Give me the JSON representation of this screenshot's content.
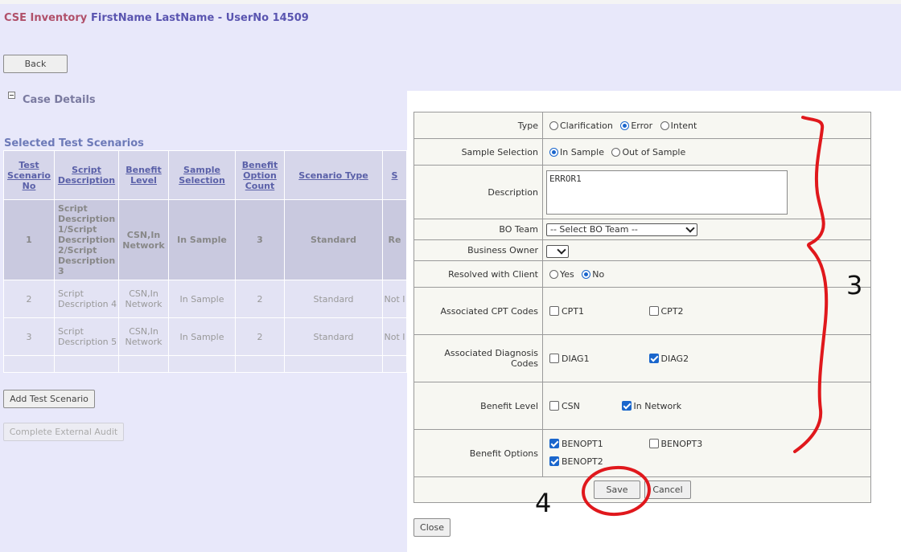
{
  "header": {
    "app_name": "CSE Inventory",
    "user": "FirstName LastName - UserNo 14509"
  },
  "buttons": {
    "back": "Back",
    "add_test_scenario": "Add Test Scenario",
    "complete_external_audit": "Complete External Audit",
    "close": "Close",
    "save": "Save",
    "cancel": "Cancel"
  },
  "case_details": {
    "title": "Case Details"
  },
  "scenarios": {
    "title": "Selected Test Scenarios",
    "columns": [
      "Test Scenario No",
      "Script Description",
      "Benefit Level",
      "Sample Selection",
      "Benefit Option Count",
      "Scenario Type",
      "S"
    ],
    "rows": [
      {
        "no": "1",
        "desc": "Script Description 1/Script Description 2/Script Description 3",
        "level": "CSN,In Network",
        "sample": "In Sample",
        "count": "3",
        "type": "Standard",
        "status": "Re"
      },
      {
        "no": "2",
        "desc": "Script Description 4",
        "level": "CSN,In Network",
        "sample": "In Sample",
        "count": "2",
        "type": "Standard",
        "status": "Not I"
      },
      {
        "no": "3",
        "desc": "Script Description 5",
        "level": "CSN,In Network",
        "sample": "In Sample",
        "count": "2",
        "type": "Standard",
        "status": "Not I"
      }
    ]
  },
  "form": {
    "type": {
      "label": "Type",
      "options": [
        "Clarification",
        "Error",
        "Intent"
      ],
      "selected": "Error"
    },
    "sample_selection": {
      "label": "Sample Selection",
      "options": [
        "In Sample",
        "Out of Sample"
      ],
      "selected": "In Sample"
    },
    "description": {
      "label": "Description",
      "value": "ERROR1"
    },
    "bo_team": {
      "label": "BO Team",
      "value": "-- Select BO Team --"
    },
    "business_owner": {
      "label": "Business Owner",
      "value": ""
    },
    "resolved": {
      "label": "Resolved with Client",
      "options": [
        "Yes",
        "No"
      ],
      "selected": "No"
    },
    "cpt": {
      "label": "Associated CPT Codes",
      "items": [
        {
          "name": "CPT1",
          "checked": false
        },
        {
          "name": "CPT2",
          "checked": false
        }
      ]
    },
    "diag": {
      "label": "Associated Diagnosis Codes",
      "items": [
        {
          "name": "DIAG1",
          "checked": false
        },
        {
          "name": "DIAG2",
          "checked": true
        }
      ]
    },
    "benefit_level": {
      "label": "Benefit Level",
      "items": [
        {
          "name": "CSN",
          "checked": false
        },
        {
          "name": "In Network",
          "checked": true
        }
      ]
    },
    "benefit_options": {
      "label": "Benefit Options",
      "items": [
        {
          "name": "BENOPT1",
          "checked": true
        },
        {
          "name": "BENOPT3",
          "checked": false
        },
        {
          "name": "BENOPT2",
          "checked": true
        }
      ]
    }
  },
  "annotations": {
    "marker_3": "3",
    "marker_4": "4",
    "color": "#e0181c"
  },
  "colors": {
    "accent": "#1a66cc",
    "page_bg": "#e8e8fa",
    "app_title": "#b0506a",
    "user_title": "#5a55b0"
  }
}
